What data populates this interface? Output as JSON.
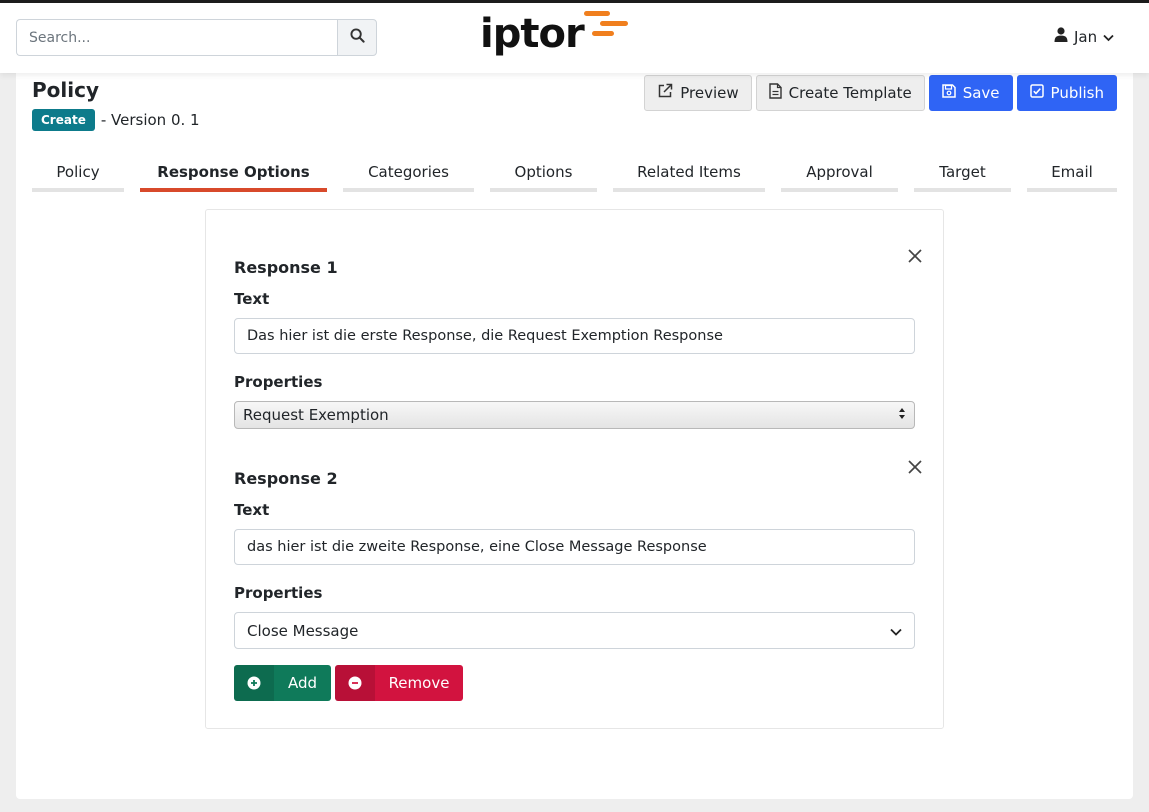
{
  "header": {
    "search": {
      "placeholder": "Search..."
    },
    "logo_text": "iptor",
    "user_name": "Jan"
  },
  "page": {
    "title": "Policy",
    "status_badge": "Create",
    "version": "- Version 0. 1"
  },
  "toolbar": {
    "preview_label": "Preview",
    "create_template_label": "Create Template",
    "save_label": "Save",
    "publish_label": "Publish"
  },
  "tabs": [
    {
      "label": "Policy",
      "active": false
    },
    {
      "label": "Response Options",
      "active": true
    },
    {
      "label": "Categories",
      "active": false
    },
    {
      "label": "Options",
      "active": false
    },
    {
      "label": "Related Items",
      "active": false
    },
    {
      "label": "Approval",
      "active": false
    },
    {
      "label": "Target",
      "active": false
    },
    {
      "label": "Email",
      "active": false
    }
  ],
  "responses": [
    {
      "title": "Response 1",
      "text_label": "Text",
      "text_value": "Das hier ist die erste Response, die Request Exemption Response",
      "properties_label": "Properties",
      "properties_value": "Request Exemption"
    },
    {
      "title": "Response 2",
      "text_label": "Text",
      "text_value": "das hier ist die zweite Response, eine Close Message Response",
      "properties_label": "Properties",
      "properties_value": "Close Message"
    }
  ],
  "actions": {
    "add_label": "Add",
    "remove_label": "Remove"
  },
  "colors": {
    "brand_orange": "#f07f1e",
    "primary_blue": "#2f64f5",
    "badge_teal": "#0d7b8b",
    "active_tab_underline": "#d84a2b",
    "add_green": "#0f7a5a",
    "remove_red": "#d2133f"
  },
  "icons": {
    "search": "search-icon",
    "user": "user-icon",
    "dropdown": "chevron-down-icon",
    "preview": "external-link-icon",
    "template": "document-icon",
    "save": "floppy-disk-icon",
    "publish": "check-square-icon",
    "close": "close-icon",
    "add": "plus-circle-icon",
    "remove": "minus-circle-icon"
  }
}
